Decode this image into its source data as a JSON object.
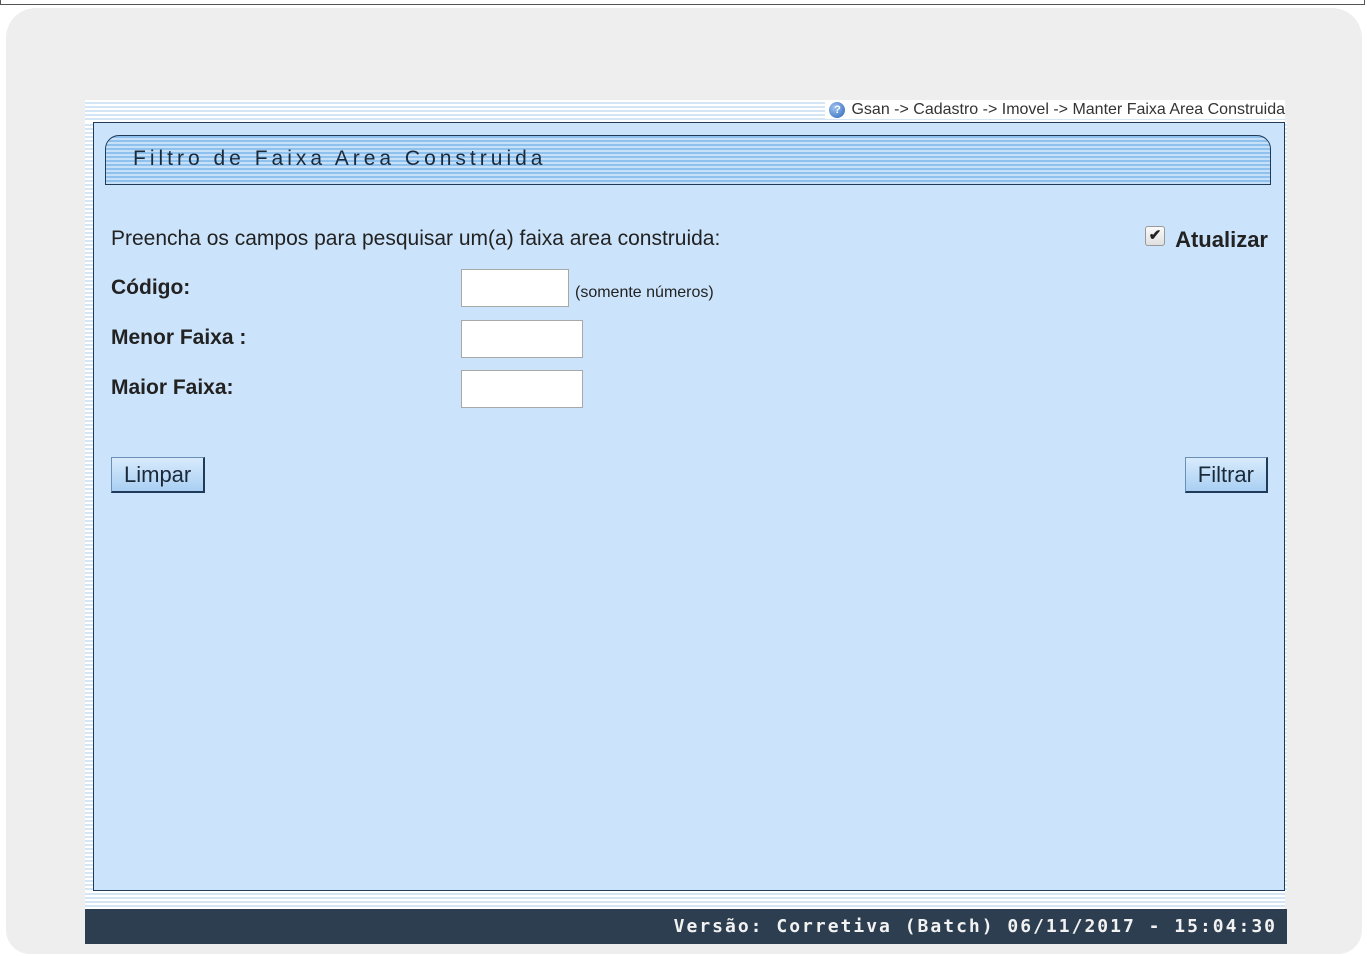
{
  "breadcrumb": "Gsan -> Cadastro -> Imovel -> Manter Faixa Area Construida",
  "form": {
    "title": "Filtro de Faixa Area Construida",
    "instruction": "Preencha os campos para pesquisar um(a) faixa area construida:",
    "atualizar_label": "Atualizar",
    "atualizar_checked": true,
    "fields": {
      "codigo": {
        "label": "Código:",
        "value": "",
        "hint": "(somente números)"
      },
      "menor_faixa": {
        "label": "Menor Faixa :",
        "value": ""
      },
      "maior_faixa": {
        "label": "Maior Faixa:",
        "value": ""
      }
    },
    "buttons": {
      "limpar": "Limpar",
      "filtrar": "Filtrar"
    }
  },
  "footer": {
    "version": "Versão: Corretiva (Batch) 06/11/2017 - 15:04:30"
  },
  "colors": {
    "panel_bg": "#cce4fb",
    "footer_bg": "#2d3e50",
    "border": "#1f3b57"
  }
}
